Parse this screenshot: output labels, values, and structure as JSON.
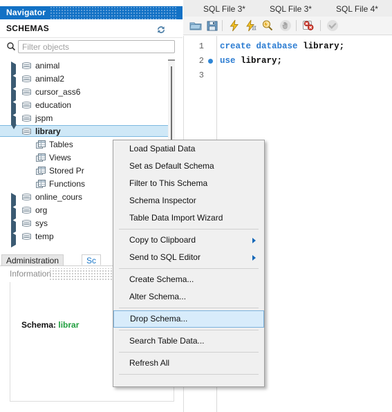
{
  "navigator": {
    "title": "Navigator",
    "schemas_label": "SCHEMAS",
    "refresh_icon": "refresh-icon",
    "filter": {
      "placeholder": "Filter objects",
      "value": "",
      "search_icon": "search-icon"
    },
    "tree": [
      {
        "label": "animal",
        "icon": "database-icon",
        "expanded": false,
        "depth": 0,
        "selected": false
      },
      {
        "label": "animal2",
        "icon": "database-icon",
        "expanded": false,
        "depth": 0,
        "selected": false
      },
      {
        "label": "cursor_ass6",
        "icon": "database-icon",
        "expanded": false,
        "depth": 0,
        "selected": false
      },
      {
        "label": "education",
        "icon": "database-icon",
        "expanded": false,
        "depth": 0,
        "selected": false
      },
      {
        "label": "jspm",
        "icon": "database-icon",
        "expanded": false,
        "depth": 0,
        "selected": false
      },
      {
        "label": "library",
        "icon": "database-icon",
        "expanded": true,
        "depth": 0,
        "selected": true
      },
      {
        "label": "Tables",
        "icon": "table-group-icon",
        "depth": 1,
        "selected": false
      },
      {
        "label": "Views",
        "icon": "table-group-icon",
        "depth": 1,
        "selected": false
      },
      {
        "label": "Stored Pr",
        "icon": "table-group-icon",
        "depth": 1,
        "selected": false
      },
      {
        "label": "Functions",
        "icon": "table-group-icon",
        "depth": 1,
        "selected": false
      },
      {
        "label": "online_cours",
        "icon": "database-icon",
        "expanded": false,
        "depth": 0,
        "selected": false
      },
      {
        "label": "org",
        "icon": "database-icon",
        "expanded": false,
        "depth": 0,
        "selected": false
      },
      {
        "label": "sys",
        "icon": "database-icon",
        "expanded": false,
        "depth": 0,
        "selected": false
      },
      {
        "label": "temp",
        "icon": "database-icon",
        "expanded": false,
        "depth": 0,
        "selected": false
      }
    ],
    "bottom_tabs": [
      {
        "label": "Administration",
        "active": false
      },
      {
        "label": "Sc",
        "active": true
      }
    ]
  },
  "information": {
    "title": "Information",
    "schema_label": "Schema:",
    "schema_value": "librar"
  },
  "editor": {
    "tabs": [
      {
        "label": "SQL File 3*"
      },
      {
        "label": "SQL File 3*"
      },
      {
        "label": "SQL File 4*"
      }
    ],
    "toolbar_icons": [
      "open-folder-icon",
      "save-icon",
      "execute-icon",
      "execute-current-statement-icon",
      "explain-icon",
      "stop-icon",
      "toggle-stop-on-error-icon",
      "commit-icon"
    ],
    "lines": [
      {
        "number": "1",
        "breakpoint": false,
        "tokens": [
          {
            "t": "create",
            "k": "kw"
          },
          {
            "t": " ",
            "k": "sp"
          },
          {
            "t": "database",
            "k": "kw"
          },
          {
            "t": " ",
            "k": "sp"
          },
          {
            "t": "library;",
            "k": "id"
          }
        ]
      },
      {
        "number": "2",
        "breakpoint": true,
        "tokens": [
          {
            "t": "use",
            "k": "kw"
          },
          {
            "t": " ",
            "k": "sp"
          },
          {
            "t": "library;",
            "k": "id"
          }
        ]
      },
      {
        "number": "3",
        "breakpoint": false,
        "tokens": []
      }
    ]
  },
  "context_menu": {
    "items": [
      {
        "label": "Load Spatial Data",
        "type": "item",
        "submenu": false,
        "highlighted": false
      },
      {
        "label": "Set as Default Schema",
        "type": "item",
        "submenu": false,
        "highlighted": false
      },
      {
        "label": "Filter to This Schema",
        "type": "item",
        "submenu": false,
        "highlighted": false
      },
      {
        "label": "Schema Inspector",
        "type": "item",
        "submenu": false,
        "highlighted": false
      },
      {
        "label": "Table Data Import Wizard",
        "type": "item",
        "submenu": false,
        "highlighted": false
      },
      {
        "label": "",
        "type": "separator",
        "submenu": false,
        "highlighted": false
      },
      {
        "label": "Copy to Clipboard",
        "type": "item",
        "submenu": true,
        "highlighted": false
      },
      {
        "label": "Send to SQL Editor",
        "type": "item",
        "submenu": true,
        "highlighted": false
      },
      {
        "label": "",
        "type": "separator",
        "submenu": false,
        "highlighted": false
      },
      {
        "label": "Create Schema...",
        "type": "item",
        "submenu": false,
        "highlighted": false
      },
      {
        "label": "Alter Schema...",
        "type": "item",
        "submenu": false,
        "highlighted": false
      },
      {
        "label": "",
        "type": "separator",
        "submenu": false,
        "highlighted": false
      },
      {
        "label": "Drop Schema...",
        "type": "item",
        "submenu": false,
        "highlighted": true
      },
      {
        "label": "",
        "type": "separator",
        "submenu": false,
        "highlighted": false
      },
      {
        "label": "Search Table Data...",
        "type": "item",
        "submenu": false,
        "highlighted": false
      },
      {
        "label": "",
        "type": "separator",
        "submenu": false,
        "highlighted": false
      },
      {
        "label": "Refresh All",
        "type": "item",
        "submenu": false,
        "highlighted": false
      },
      {
        "label": "",
        "type": "separator",
        "submenu": false,
        "highlighted": false
      }
    ]
  },
  "colors": {
    "nav_header_blue": "#1271c5",
    "selection_blue": "#cfe8f7",
    "menu_highlight": "#d8ecfb",
    "sql_keyword": "#2d7dd2",
    "schema_value_green": "#1f9e3e",
    "active_tab_text": "#1976c8"
  }
}
